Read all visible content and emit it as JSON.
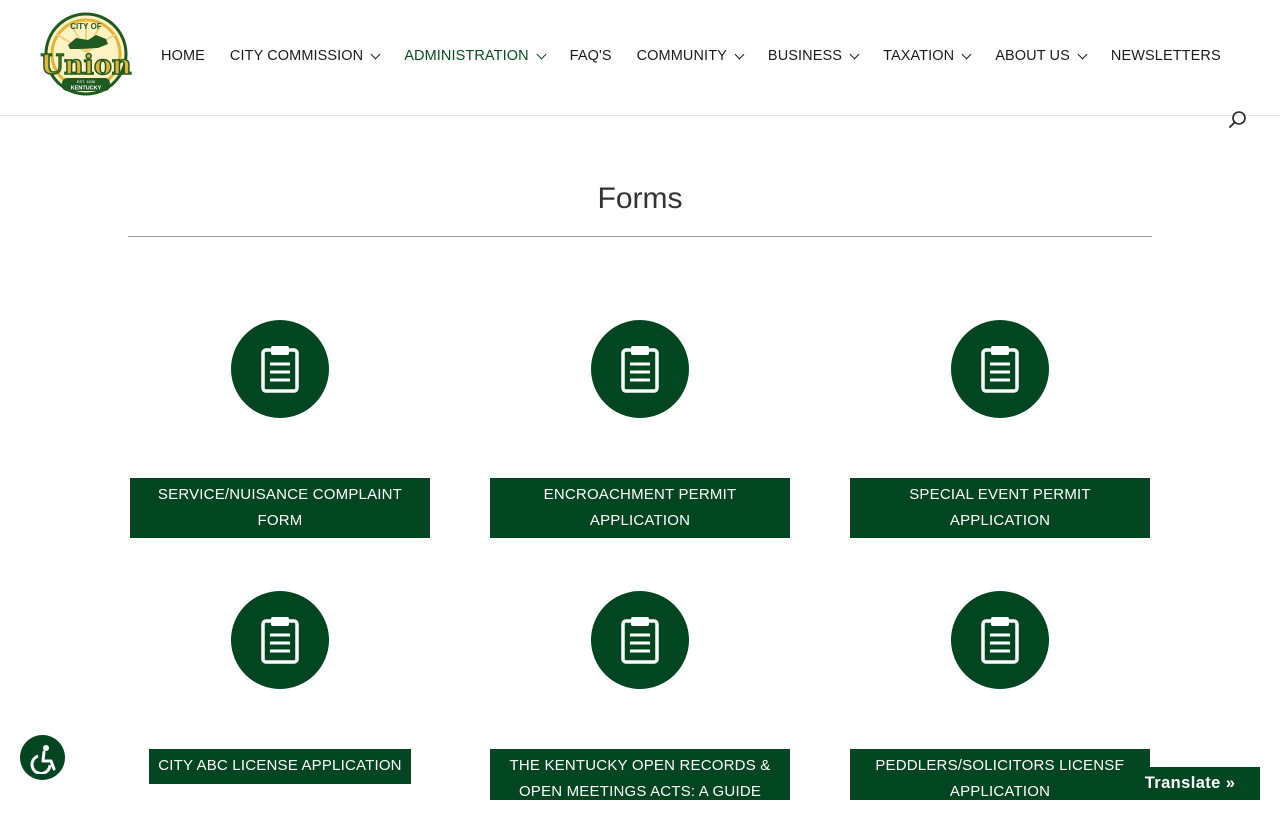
{
  "logo": {
    "top_text": "CITY OF",
    "name": "Union",
    "est": "EST. 1838",
    "state": "KENTUCKY",
    "colors": {
      "green": "#1f5a22",
      "gold": "#e2b43a",
      "cream": "#fff3c4"
    }
  },
  "nav": {
    "items": [
      {
        "label": "HOME",
        "has_dropdown": false,
        "active": false
      },
      {
        "label": "CITY COMMISSION",
        "has_dropdown": true,
        "active": false
      },
      {
        "label": "ADMINISTRATION",
        "has_dropdown": true,
        "active": true
      },
      {
        "label": "FAQ'S",
        "has_dropdown": false,
        "active": false
      },
      {
        "label": "COMMUNITY",
        "has_dropdown": true,
        "active": false
      },
      {
        "label": "BUSINESS",
        "has_dropdown": true,
        "active": false
      },
      {
        "label": "TAXATION",
        "has_dropdown": true,
        "active": false
      },
      {
        "label": "ABOUT US",
        "has_dropdown": true,
        "active": false
      },
      {
        "label": "NEWSLETTERS",
        "has_dropdown": false,
        "active": false
      }
    ],
    "search_icon": "search-icon"
  },
  "page": {
    "title": "Forms"
  },
  "forms": [
    {
      "label": "SERVICE/NUISANCE COMPLAINT FORM",
      "icon": "clipboard-icon"
    },
    {
      "label": "ENCROACHMENT PERMIT APPLICATION",
      "icon": "clipboard-icon"
    },
    {
      "label": "SPECIAL EVENT PERMIT APPLICATION",
      "icon": "clipboard-icon"
    },
    {
      "label": "CITY ABC LICENSE APPLICATION",
      "icon": "clipboard-icon"
    },
    {
      "label": "THE KENTUCKY OPEN RECORDS & OPEN MEETINGS ACTS: A GUIDE FOR",
      "icon": "clipboard-icon"
    },
    {
      "label": "PEDDLERS/SOLICITORS LICENSE APPLICATION",
      "icon": "clipboard-icon"
    }
  ],
  "widgets": {
    "accessibility_icon": "accessibility-icon",
    "translate_label": "Translate »"
  },
  "colors": {
    "brand_green": "#024521",
    "active_nav": "#0a4a20",
    "text": "#1b1b1b"
  }
}
